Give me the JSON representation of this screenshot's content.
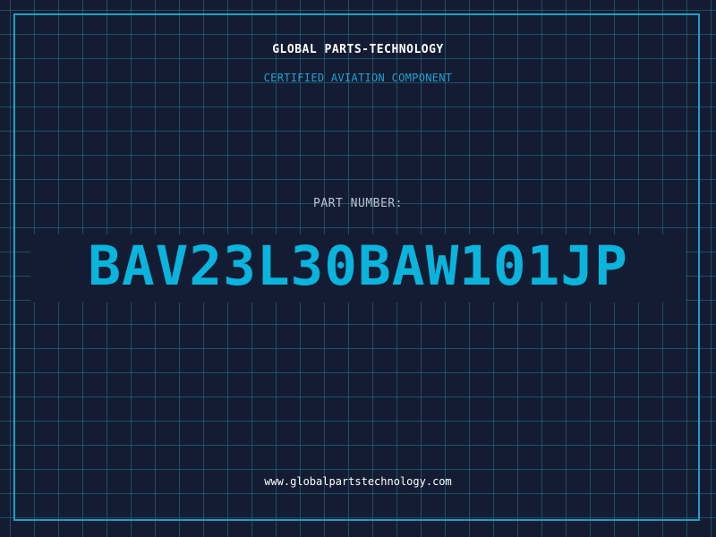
{
  "header": {
    "company": "GLOBAL PARTS-TECHNOLOGY",
    "subtitle": "CERTIFIED AVIATION COMPONENT"
  },
  "part": {
    "label": "PART NUMBER:",
    "number": "BAV23L30BAW101JP"
  },
  "footer": {
    "website": "www.globalpartstechnology.com"
  },
  "colors": {
    "background": "#141c33",
    "grid": "#28768a",
    "accent": "#1e9fc6",
    "part_number": "#0ab4dc",
    "text_light": "#ffffff",
    "text_muted": "#b9c2cf"
  }
}
